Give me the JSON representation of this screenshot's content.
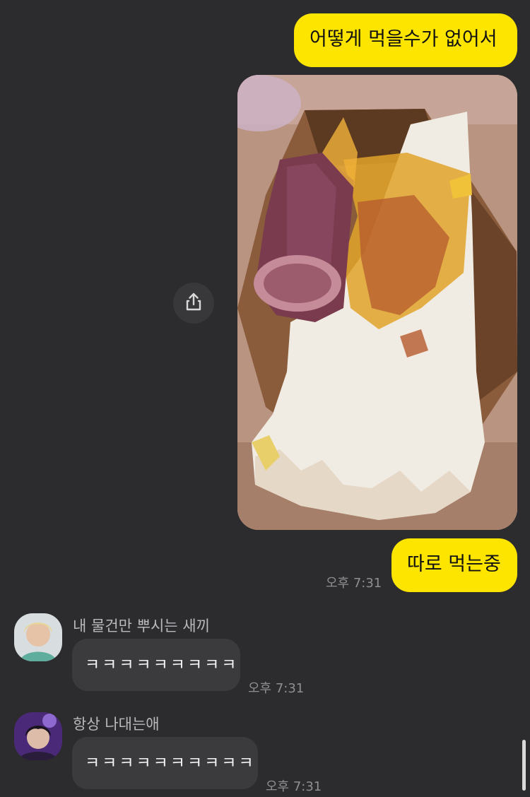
{
  "messages": {
    "out_1": {
      "text": "어떻게 먹을수가 없어서"
    },
    "out_2": {
      "text": "따로 먹는중",
      "time": "오후 7:31"
    },
    "in_1": {
      "sender": "내 물건만 뿌시는 새끼",
      "text": "ㅋㅋㅋㅋㅋㅋㅋㅋㅋ",
      "time": "오후 7:31"
    },
    "in_2": {
      "sender": "항상 나대는애",
      "text": "ㅋㅋㅋㅋㅋㅋㅋㅋㅋㅋ",
      "time": "오후 7:31"
    }
  },
  "icons": {
    "share": "share-icon"
  },
  "colors": {
    "background": "#2c2c2e",
    "outgoing_bubble": "#fee500",
    "incoming_bubble": "#3b3b3e",
    "timestamp": "#8e8e93"
  }
}
